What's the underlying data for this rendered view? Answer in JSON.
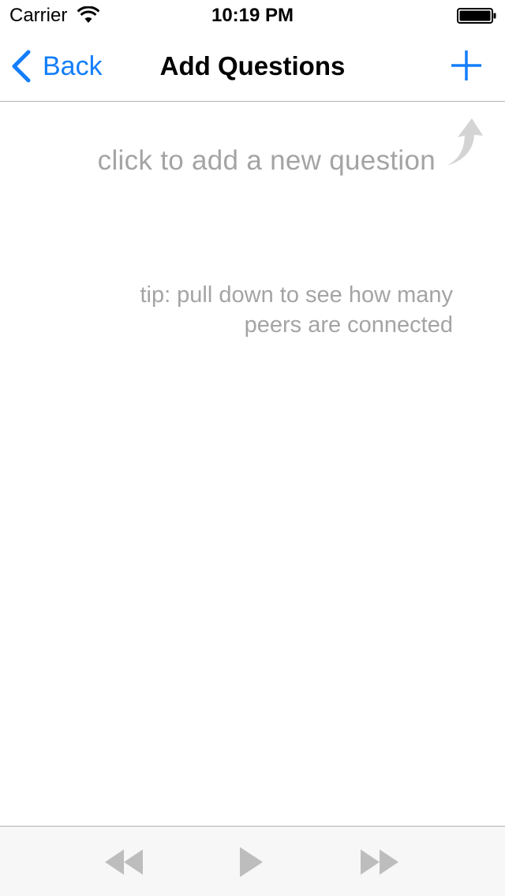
{
  "status_bar": {
    "carrier": "Carrier",
    "time": "10:19 PM",
    "wifi_icon": "wifi-icon",
    "battery_icon": "battery-icon"
  },
  "nav_bar": {
    "back_label": "Back",
    "title": "Add Questions",
    "add_icon": "plus-icon",
    "accent_color": "#147efb"
  },
  "content": {
    "hint": "click to add a new question",
    "tip": "tip: pull down to see how many peers are connected",
    "text_color": "#a4a4a4"
  },
  "toolbar": {
    "buttons": [
      {
        "icon": "rewind-icon",
        "enabled": false
      },
      {
        "icon": "play-icon",
        "enabled": false
      },
      {
        "icon": "fast-forward-icon",
        "enabled": false
      }
    ],
    "disabled_color": "#bdbdbd"
  }
}
